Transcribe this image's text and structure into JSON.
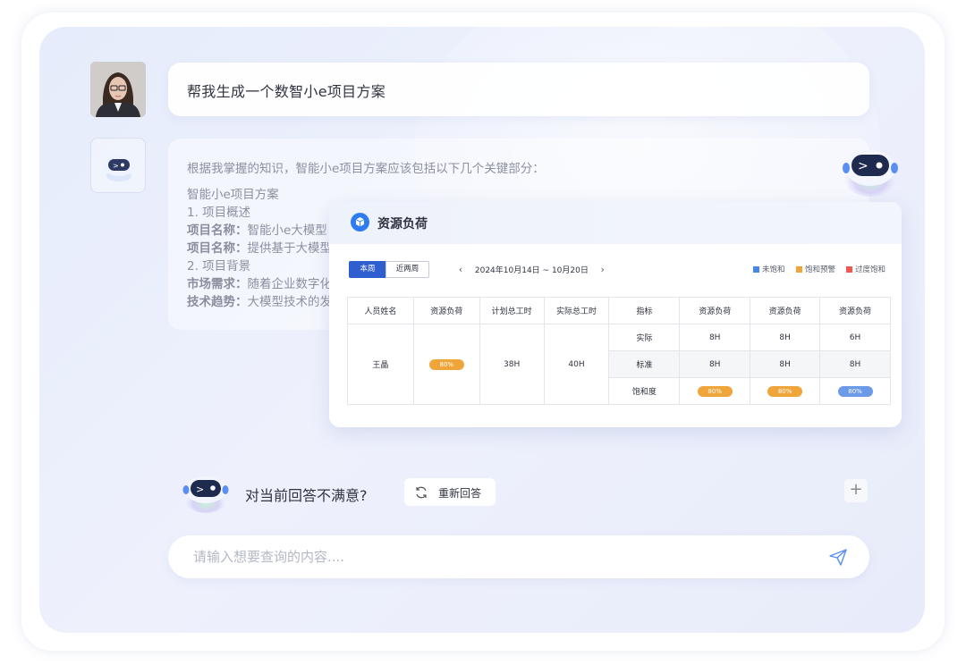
{
  "user_prompt": "帮我生成一个数智小e项目方案",
  "answer": {
    "intro": "根据我掌握的知识，智能小e项目方案应该包括以下几个关键部分：",
    "heading": "智能小e项目方案",
    "section1": "1. 项目概述",
    "item1_label": "项目名称：",
    "item1_text": "智能小e大模型",
    "item2_label": "项目名称：",
    "item2_text": "提供基于大模型",
    "section2": "2. 项目背景",
    "item3_label": "市场需求：",
    "item3_text": "随着企业数字化",
    "item4_label": "技术趋势：",
    "item4_text": "大模型技术的发"
  },
  "card": {
    "title": "资源负荷",
    "tab_this_week": "本周",
    "tab_two_weeks": "近两周",
    "date_range": "2024年10月14日 ~ 10月20日",
    "legend": [
      {
        "label": "未饱和",
        "color": "#4a86e8"
      },
      {
        "label": "饱和预警",
        "color": "#f0a53a"
      },
      {
        "label": "过度饱和",
        "color": "#ee5a52"
      }
    ],
    "table": {
      "headers": [
        "人员姓名",
        "资源负荷",
        "计划总工时",
        "实际总工时",
        "指标",
        "资源负荷",
        "资源负荷",
        "资源负荷"
      ],
      "name": "王晶",
      "load_pill": "80%",
      "planned_hours": "38H",
      "actual_hours": "40H",
      "rows": [
        {
          "metric": "实际",
          "values": [
            "8H",
            "8H",
            "6H"
          ]
        },
        {
          "metric": "标准",
          "values": [
            "8H",
            "8H",
            "8H"
          ]
        },
        {
          "metric": "饱和度",
          "pills": [
            "80%",
            "80%",
            "80%"
          ]
        }
      ]
    }
  },
  "feedback": {
    "question": "对当前回答不满意?",
    "regenerate": "重新回答",
    "plus": "+"
  },
  "input": {
    "placeholder": "请输入想要查询的内容...."
  },
  "colors": {
    "accent_blue": "#2f5fcf",
    "pill_orange": "#f0a53a",
    "pill_blue": "#6c9ae8"
  }
}
